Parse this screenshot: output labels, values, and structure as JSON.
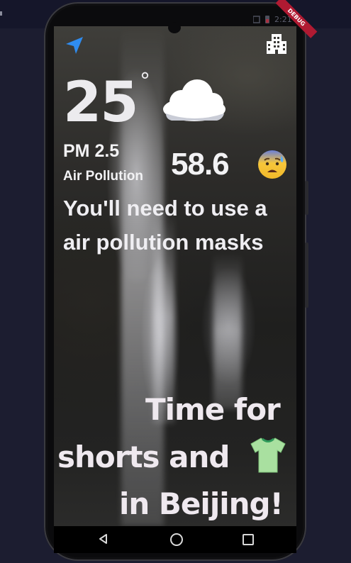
{
  "status_bar": {
    "time": "2:21"
  },
  "debug_banner": "DEBUG",
  "weather": {
    "temperature": "25",
    "degree_symbol": "°",
    "condition_icon": "cloud-icon"
  },
  "air": {
    "metric_label": "PM 2.5",
    "sub_label": "Air Pollution",
    "value": "58.6",
    "emoji_icon": "worried-face-icon"
  },
  "advice": "You'll need to use a air pollution masks",
  "headline": {
    "line1": "Time for",
    "line2": "shorts and",
    "line3": "in Beijing!",
    "emoji_icon": "t-shirt-icon"
  },
  "icons": {
    "location": "navigation-arrow-icon",
    "city": "city-buildings-icon"
  },
  "colors": {
    "accent_blue": "#2f8cf0",
    "text": "#f0eef2",
    "banner": "#b01a32"
  }
}
